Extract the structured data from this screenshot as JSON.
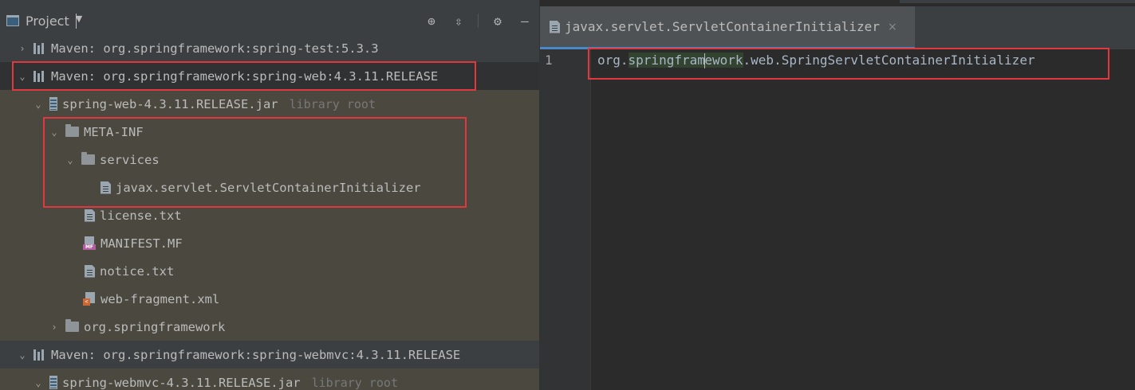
{
  "project_panel": {
    "title": "Project",
    "tools": [
      "target-icon",
      "collapse-icon",
      "gear-icon",
      "minimize-icon"
    ]
  },
  "tree": {
    "r0": {
      "label": "Maven: org.springframework:spring-test:5.3.3"
    },
    "r1": {
      "label": "Maven: org.springframework:spring-web:4.3.11.RELEASE"
    },
    "r2": {
      "label": "spring-web-4.3.11.RELEASE.jar",
      "note": "library root"
    },
    "r3": {
      "label": "META-INF"
    },
    "r4": {
      "label": "services"
    },
    "r5": {
      "label": "javax.servlet.ServletContainerInitializer"
    },
    "r6": {
      "label": "license.txt"
    },
    "r7": {
      "label": "MANIFEST.MF",
      "badge": "MF"
    },
    "r8": {
      "label": "notice.txt"
    },
    "r9": {
      "label": "web-fragment.xml"
    },
    "r10": {
      "label": "org.springframework"
    },
    "r11": {
      "label": "Maven: org.springframework:spring-webmvc:4.3.11.RELEASE"
    },
    "r12": {
      "label": "spring-webmvc-4.3.11.RELEASE.jar",
      "note": "library root"
    }
  },
  "editor": {
    "tab": {
      "label": "javax.servlet.ServletContainerInitializer",
      "close": "×"
    },
    "line_number": "1",
    "code": {
      "a": "org.",
      "b": "springfram",
      "c": "ework",
      "d": ".web.SpringServletContainerInitializer"
    }
  },
  "colors": {
    "highlight_box": "#e0383e",
    "selected_row": "#4b483f",
    "accent": "#4a88c7"
  }
}
